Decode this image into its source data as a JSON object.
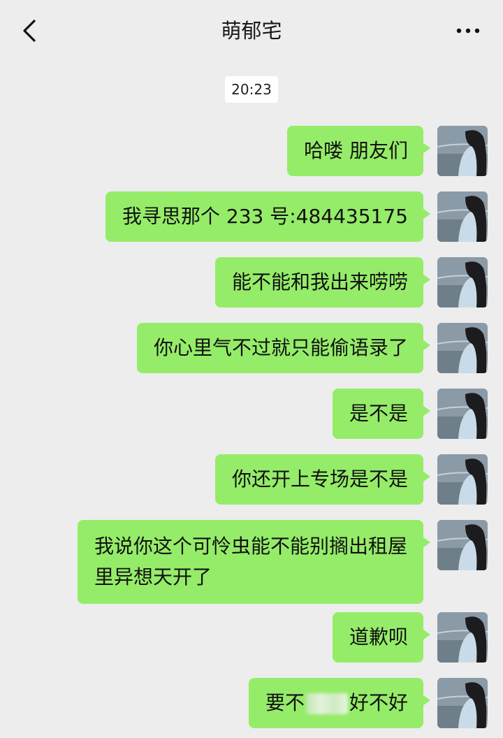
{
  "header": {
    "title": "萌郁宅",
    "back_icon": "chevron-left-icon",
    "more_icon": "ellipsis-icon"
  },
  "timestamp": "20:23",
  "colors": {
    "background": "#ededed",
    "bubble_green": "#95ec69",
    "timestamp_bg": "#ffffff"
  },
  "messages": [
    {
      "text": "哈喽 朋友们"
    },
    {
      "text": "我寻思那个 233 号:484435175"
    },
    {
      "text": "能不能和我出来唠唠"
    },
    {
      "text": "你心里气不过就只能偷语录了"
    },
    {
      "text": "是不是"
    },
    {
      "text": "你还开上专场是不是"
    },
    {
      "text": "我说你这个可怜虫能不能别搁出租屋里异想天开了"
    },
    {
      "text": "道歉呗"
    },
    {
      "text_before": "要不",
      "text_after": "好不好"
    }
  ]
}
